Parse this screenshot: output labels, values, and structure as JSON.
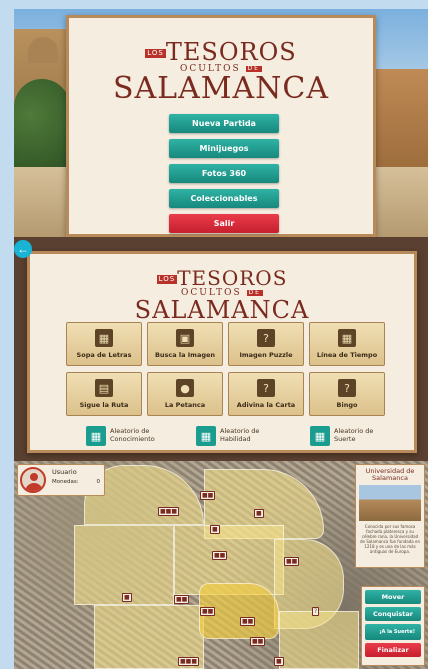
{
  "logo": {
    "los": "LOS",
    "line1": "TESOROS",
    "line2": "OCULTOS",
    "de": "DE",
    "line3": "SALAMANCA"
  },
  "main_menu": {
    "buttons": [
      "Nueva Partida",
      "Minijuegos",
      "Fotos 360",
      "Coleccionables",
      "Salir"
    ]
  },
  "minigames": {
    "back_icon": "arrow-left-icon",
    "games": [
      {
        "label": "Sopa de Letras",
        "icon": "grid-icon"
      },
      {
        "label": "Busca la Imagen",
        "icon": "image-icon"
      },
      {
        "label": "Imagen Puzzle",
        "icon": "puzzle-icon"
      },
      {
        "label": "Línea de Tiempo",
        "icon": "timeline-icon"
      },
      {
        "label": "Sigue la Ruta",
        "icon": "route-icon"
      },
      {
        "label": "La Petanca",
        "icon": "petanque-icon"
      },
      {
        "label": "Adivina la Carta",
        "icon": "card-icon"
      },
      {
        "label": "Bingo",
        "icon": "bingo-icon"
      }
    ],
    "random": [
      {
        "label": "Aleatorio de Conocimiento"
      },
      {
        "label": "Aleatorio de Habilidad"
      },
      {
        "label": "Aleatorio de Suerte"
      }
    ]
  },
  "map": {
    "user": {
      "name": "Usuario",
      "row1_label": "Monedas:",
      "row1_value": "0"
    },
    "info": {
      "title": "Universidad de Salamanca",
      "description": "Conocida por sus famosa fachada plateresca y su célebre rana, la Universidad de Salamanca fue fundada en 1218 y es una de las más antiguas de Europa."
    },
    "actions": {
      "move": "Mover",
      "conquer": "Conquistar",
      "luck": "¡A la Suerte!",
      "finish": "Finalizar"
    },
    "accent": "#17887c",
    "danger": "#c61f2e"
  }
}
